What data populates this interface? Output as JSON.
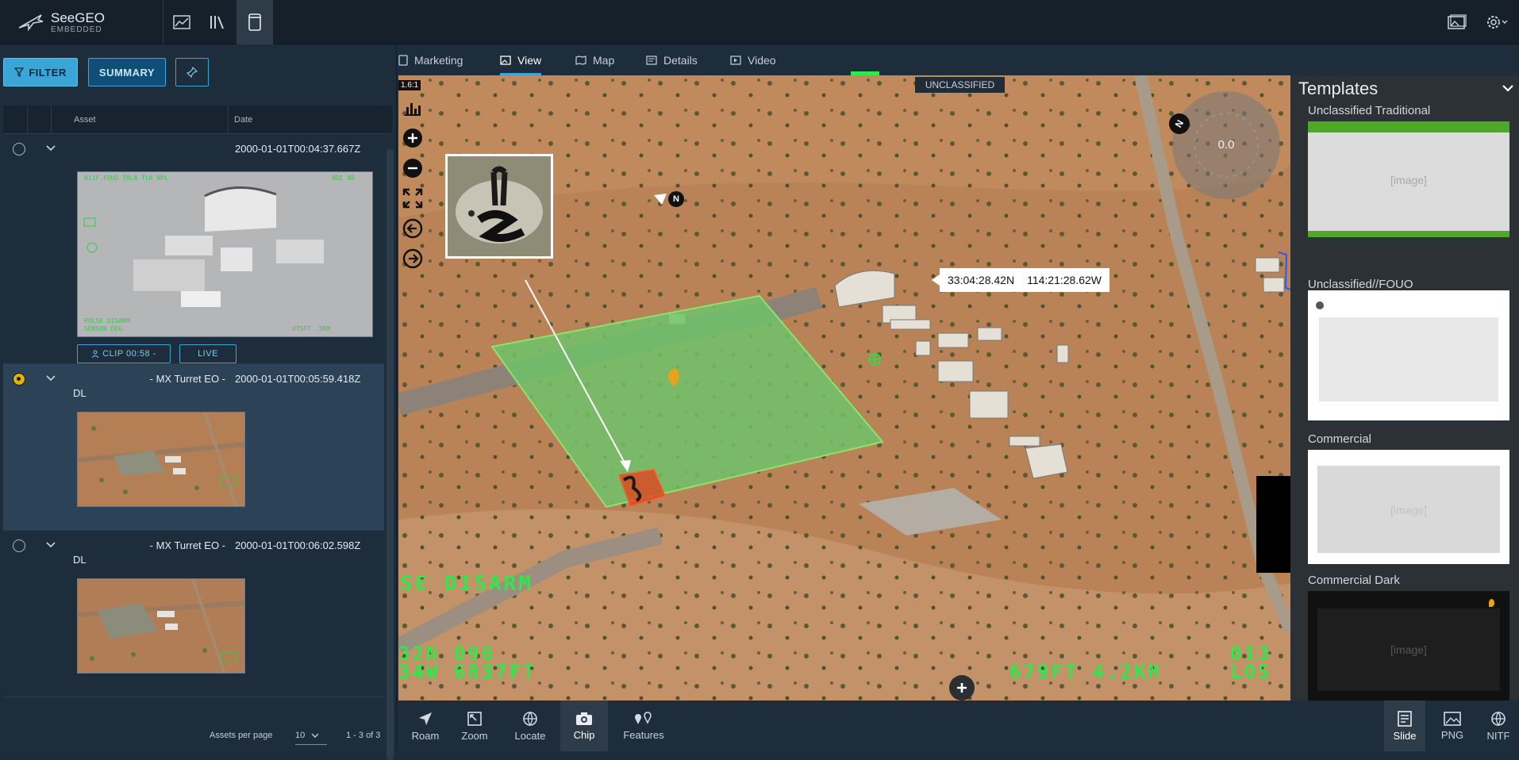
{
  "app": {
    "title": "SeeGEO",
    "subtitle": "EMBEDDED"
  },
  "left": {
    "filter_label": "FILTER",
    "summary_label": "SUMMARY",
    "columns": {
      "asset": "Asset",
      "date": "Date"
    },
    "rows": [
      {
        "name": "",
        "name2": "",
        "date": "2000-01-01T00:04:37.667Z",
        "clip": "CLIP 00:58 -",
        "live": "LIVE"
      },
      {
        "name": "- MX Turret EO -",
        "name2": "DL",
        "date": "2000-01-01T00:05:59.418Z"
      },
      {
        "name": "- MX Turret EO -",
        "name2": "DL",
        "date": "2000-01-01T00:06:02.598Z"
      }
    ],
    "pager": {
      "per_page_label": "Assets per page",
      "per_page": "10",
      "range": "1 - 3 of 3"
    }
  },
  "tabs": [
    "Marketing",
    "View",
    "Map",
    "Details",
    "Video"
  ],
  "map": {
    "classification": "UNCLASSIFIED",
    "zoom_label": "1.6:1",
    "lat": "33:04:28.42N",
    "lon": "114:21:28.62W",
    "compass_value": "0.0",
    "north_label": "N",
    "hud": {
      "disarm": "SE  DISARM",
      "line1": "32N  096",
      "line2": "34W  6837FT",
      "right1": "679FT   4.2KM",
      "right_top": "013",
      "right_bottom": "LOS"
    }
  },
  "templates": {
    "title": "Templates",
    "placeholder": "[image]",
    "items": [
      {
        "name": "Unclassified Traditional"
      },
      {
        "name": "Unclassified//FOUO"
      },
      {
        "name": "Commercial"
      },
      {
        "name": "Commercial Dark"
      }
    ]
  },
  "tools": [
    "Roam",
    "Zoom",
    "Locate",
    "Chip",
    "Features"
  ],
  "exports": [
    "Slide",
    "PNG",
    "NITF"
  ],
  "colors": {
    "accent": "#3aa5d6",
    "aoi_fill": "#6fc36a",
    "chip_fill": "#e0451f",
    "hud_green": "#2ee84c"
  }
}
